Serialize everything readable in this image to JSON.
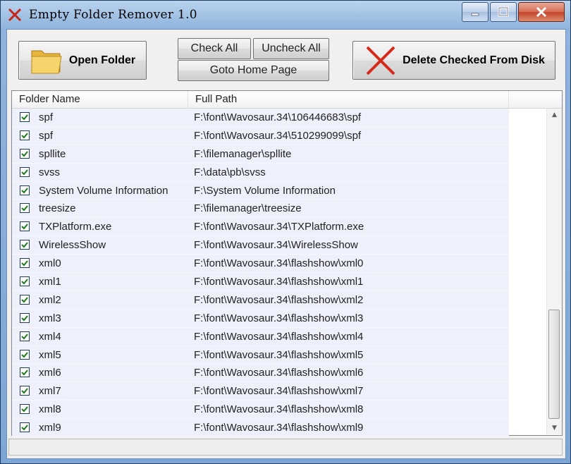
{
  "window": {
    "title": "Empty Folder Remover 1.0"
  },
  "toolbar": {
    "open_folder": "Open Folder",
    "check_all": "Check All",
    "uncheck_all": "Uncheck All",
    "goto_home": "Goto Home Page",
    "delete_checked": "Delete Checked From Disk"
  },
  "columns": {
    "name": "Folder Name",
    "path": "Full Path"
  },
  "rows": [
    {
      "name": "spf",
      "path": "F:\\font\\Wavosaur.34\\106446683\\spf",
      "checked": true
    },
    {
      "name": "spf",
      "path": "F:\\font\\Wavosaur.34\\510299099\\spf",
      "checked": true
    },
    {
      "name": "spllite",
      "path": "F:\\filemanager\\spllite",
      "checked": true
    },
    {
      "name": "svss",
      "path": "F:\\data\\pb\\svss",
      "checked": true
    },
    {
      "name": "System Volume Information",
      "path": "F:\\System Volume Information",
      "checked": true
    },
    {
      "name": "treesize",
      "path": "F:\\filemanager\\treesize",
      "checked": true
    },
    {
      "name": "TXPlatform.exe",
      "path": "F:\\font\\Wavosaur.34\\TXPlatform.exe",
      "checked": true
    },
    {
      "name": "WirelessShow",
      "path": "F:\\font\\Wavosaur.34\\WirelessShow",
      "checked": true
    },
    {
      "name": "xml0",
      "path": "F:\\font\\Wavosaur.34\\flashshow\\xml0",
      "checked": true
    },
    {
      "name": "xml1",
      "path": "F:\\font\\Wavosaur.34\\flashshow\\xml1",
      "checked": true
    },
    {
      "name": "xml2",
      "path": "F:\\font\\Wavosaur.34\\flashshow\\xml2",
      "checked": true
    },
    {
      "name": "xml3",
      "path": "F:\\font\\Wavosaur.34\\flashshow\\xml3",
      "checked": true
    },
    {
      "name": "xml4",
      "path": "F:\\font\\Wavosaur.34\\flashshow\\xml4",
      "checked": true
    },
    {
      "name": "xml5",
      "path": "F:\\font\\Wavosaur.34\\flashshow\\xml5",
      "checked": true
    },
    {
      "name": "xml6",
      "path": "F:\\font\\Wavosaur.34\\flashshow\\xml6",
      "checked": true
    },
    {
      "name": "xml7",
      "path": "F:\\font\\Wavosaur.34\\flashshow\\xml7",
      "checked": true
    },
    {
      "name": "xml8",
      "path": "F:\\font\\Wavosaur.34\\flashshow\\xml8",
      "checked": true
    },
    {
      "name": "xml9",
      "path": "F:\\font\\Wavosaur.34\\flashshow\\xml9",
      "checked": true
    }
  ],
  "icons": {
    "app": "red-x-icon",
    "open_folder": "folder-icon",
    "delete": "red-x-icon",
    "minimize": "minimize-icon",
    "maximize": "maximize-icon",
    "close": "close-icon"
  },
  "colors": {
    "accent_red": "#d42a1a",
    "row_bg": "#eef1fb",
    "check_green": "#1a7a1a"
  }
}
